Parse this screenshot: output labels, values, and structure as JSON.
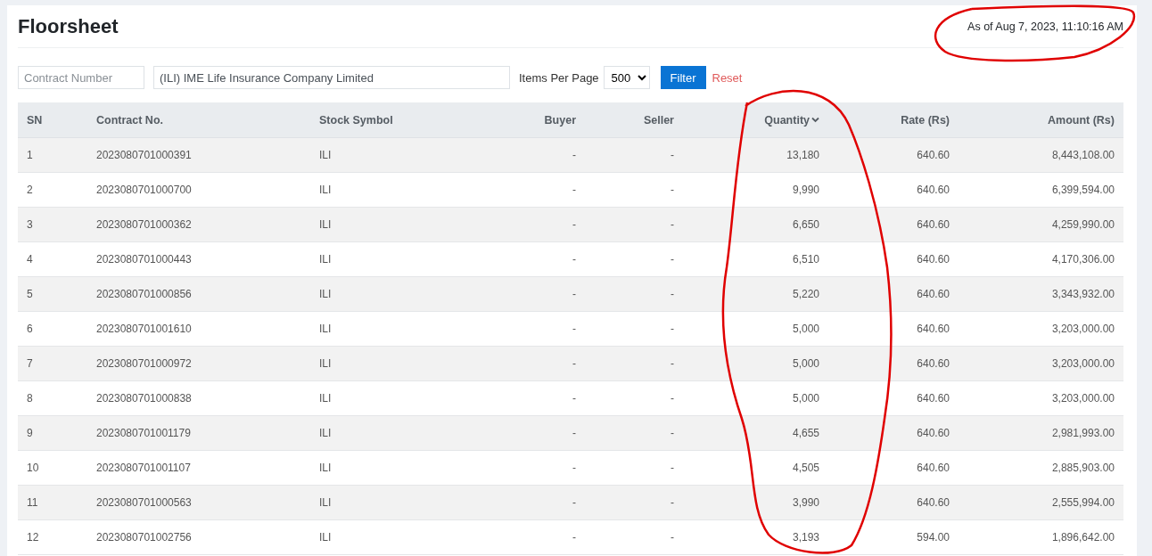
{
  "title": "Floorsheet",
  "as_of": "As of Aug 7, 2023, 11:10:16 AM",
  "filters": {
    "contract_number": {
      "placeholder": "Contract Number"
    },
    "stock": {
      "value": "(ILI) IME Life Insurance Company Limited"
    },
    "items_per_page": {
      "label": "Items Per Page",
      "value": "500"
    },
    "buttons": [
      {
        "kind": "primary",
        "label": "Filter"
      },
      {
        "kind": "link",
        "label": "Reset"
      }
    ]
  },
  "table": {
    "columns": [
      {
        "label": "SN",
        "sorted": false
      },
      {
        "label": "Contract No.",
        "sorted": false
      },
      {
        "label": "Stock Symbol",
        "sorted": false
      },
      {
        "label": "Buyer",
        "sorted": false
      },
      {
        "label": "Seller",
        "sorted": false
      },
      {
        "label": "Quantity",
        "sorted": true
      },
      {
        "label": "Rate (Rs)",
        "sorted": false
      },
      {
        "label": "Amount (Rs)",
        "sorted": false
      }
    ],
    "rows": [
      [
        "1",
        "2023080701000391",
        "ILI",
        "-",
        "-",
        "13,180",
        "640.60",
        "8,443,108.00"
      ],
      [
        "2",
        "2023080701000700",
        "ILI",
        "-",
        "-",
        "9,990",
        "640.60",
        "6,399,594.00"
      ],
      [
        "3",
        "2023080701000362",
        "ILI",
        "-",
        "-",
        "6,650",
        "640.60",
        "4,259,990.00"
      ],
      [
        "4",
        "2023080701000443",
        "ILI",
        "-",
        "-",
        "6,510",
        "640.60",
        "4,170,306.00"
      ],
      [
        "5",
        "2023080701000856",
        "ILI",
        "-",
        "-",
        "5,220",
        "640.60",
        "3,343,932.00"
      ],
      [
        "6",
        "2023080701001610",
        "ILI",
        "-",
        "-",
        "5,000",
        "640.60",
        "3,203,000.00"
      ],
      [
        "7",
        "2023080701000972",
        "ILI",
        "-",
        "-",
        "5,000",
        "640.60",
        "3,203,000.00"
      ],
      [
        "8",
        "2023080701000838",
        "ILI",
        "-",
        "-",
        "5,000",
        "640.60",
        "3,203,000.00"
      ],
      [
        "9",
        "2023080701001179",
        "ILI",
        "-",
        "-",
        "4,655",
        "640.60",
        "2,981,993.00"
      ],
      [
        "10",
        "2023080701001107",
        "ILI",
        "-",
        "-",
        "4,505",
        "640.60",
        "2,885,903.00"
      ],
      [
        "11",
        "2023080701000563",
        "ILI",
        "-",
        "-",
        "3,990",
        "640.60",
        "2,555,994.00"
      ],
      [
        "12",
        "2023080701002756",
        "ILI",
        "-",
        "-",
        "3,193",
        "594.00",
        "1,896,642.00"
      ]
    ]
  }
}
